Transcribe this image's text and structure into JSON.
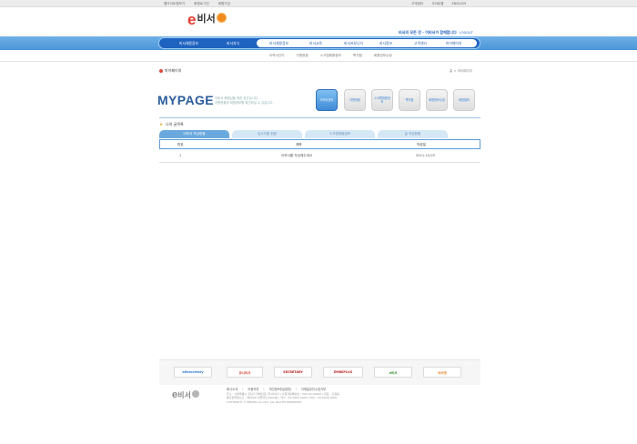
{
  "util_bar": {
    "left_links": [
      "웹사이트맵보기",
      "회원로그인",
      "회원가입"
    ],
    "right_links": [
      "고객센터",
      "사이트맵",
      "ENGLISH"
    ]
  },
  "logo": {
    "mark": "e",
    "text": "비서"
  },
  "slogan": {
    "main": "비서의 모든 것 - 이비서가 함께합니다",
    "sub": "LOGOUT"
  },
  "nav": {
    "left_items": [
      "비서채용정보",
      "비서지식"
    ],
    "items": [
      "비서채용정보",
      "비서교육",
      "비서커뮤니티",
      "비서정보",
      "고객센터",
      "마이페이지"
    ]
  },
  "subnav": [
    "이력서관리",
    "지원현황",
    "스크랩채용정보",
    "쪽지함",
    "회원정보수정"
  ],
  "section": {
    "title": "마이페이지",
    "breadcrumb": "홈 > 마이페이지"
  },
  "mypage": {
    "title": "MYPAGE",
    "desc_line1": "이비서 회원님을 위한 공간입니다.",
    "desc_line2": "지원현황과 회원정보를 확인하실 수 있습니다."
  },
  "quick_buttons": [
    {
      "label": "이력서관리",
      "active": true
    },
    {
      "label": "지원현황",
      "active": false
    },
    {
      "label": "스크랩채용정보",
      "active": false
    },
    {
      "label": "쪽지함",
      "active": false
    },
    {
      "label": "회원정보수정",
      "active": false
    },
    {
      "label": "회원탈퇴",
      "active": false
    }
  ],
  "list": {
    "title": "나의 글목록",
    "tabs": [
      "이력서 작성현황",
      "입사지원 현황",
      "스크랩채용정보",
      "글 작성현황"
    ],
    "columns": [
      "번호",
      "제목",
      "작성일"
    ],
    "rows": [
      {
        "no": "1",
        "title": "이력서를 작성해주세요",
        "date": "2011-10-05"
      }
    ]
  },
  "partners": [
    "bitsecretary",
    "유니비서",
    "SECRETARY",
    "EMBEPLUS",
    "e비서",
    "비서넷"
  ],
  "partner_colors": [
    "#2f7bd2",
    "#d3402d",
    "#b81d1d",
    "#c02626",
    "#2e8a2e",
    "#e07a1c"
  ],
  "footer": {
    "links": [
      "회사소개",
      "이용약관",
      "개인정보취급방침",
      "이메일무단수집거부"
    ],
    "info_line1": "주소 : 서울특별시 강남구 테헤란로 (주)이비서 | 사업자등록번호 : 000-00-00000 | 대표 : 홍길동",
    "info_line2": "통신판매업신고 : 제0000-서울강남-0000호 | TEL : 02-0000-0000 | FAX : 02-0000-0000",
    "info_line3": "COPYRIGHT © EBISEO CO.,LTD. ALL RIGHTS RESERVED."
  }
}
